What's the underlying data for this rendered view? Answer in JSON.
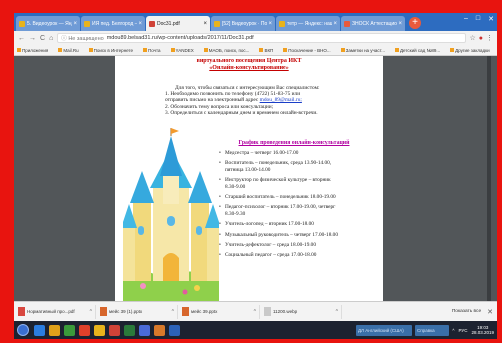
{
  "browser": {
    "tabs": [
      {
        "label": "5. Видеоурок — Яндекс",
        "icon_color": "#e8b31c",
        "active": false
      },
      {
        "label": "ИЯ пед. Белгород — Ян",
        "icon_color": "#e8b31c",
        "active": false
      },
      {
        "label": "Doc31.pdf",
        "icon_color": "#d04237",
        "active": true
      },
      {
        "label": "[52] Видеоурок · Поиск",
        "icon_color": "#e8b31c",
        "active": false
      },
      {
        "label": "тетр — Яндекс: нашлось",
        "icon_color": "#e8b31c",
        "active": false
      },
      {
        "label": "ЗНОСК Аттестационный",
        "icon_color": "#e85a3c",
        "active": false
      }
    ],
    "new_tab_label": "+",
    "address": {
      "nav_back": "←",
      "nav_forward": "→",
      "reload": "C",
      "home": "⌂",
      "security": "ⓘ Не защищено",
      "url": "mdou89.belsad31.ru/wp-content/uploads/2017/11/Doc31.pdf"
    },
    "bookmarks": [
      "Приложения",
      "Mail.Ru",
      "Поиск в Интернете",
      "Почта",
      "YANDEX",
      "МАОБ, поиск, пос...",
      "ВКП",
      "Поскачение - ВНО...",
      "Заметки на участ...",
      "Детский сад №89...",
      "Другие закладки"
    ]
  },
  "document": {
    "title_line1": "виртуального посещения Центра ИКТ",
    "title_line2": "«Онлайн-консультирование»",
    "intro": "Для того, чтобы связаться с интересующим Вас специалистом:",
    "step1a": "1.  Необходимо    позвонить   по  телефону  (4722)  51-83-75   или",
    "step1b": "     отправить письмо на электронный адрес ",
    "email": "mdou_89@mail.ru;",
    "step2": "2.  Обозначить тему вопроса или консультации;",
    "step3": "3.  Определиться с календарным днем и временем онлайн-встречи.",
    "schedule_title": "График проведения онлайн-консультаций",
    "schedule": [
      [
        "Медсестра – четверг 16.00-17.00"
      ],
      [
        "Воспитатель – понедельник, среда 13.90-14.00,",
        "пятница 13.00-14.00"
      ],
      [
        "Инструктор по физической культуре – вторник",
        "8.30-9.00"
      ],
      [
        "Старший воспитатель – понедельник 18.00-19.00"
      ],
      [
        "Педагог-психолог – вторник 17.00-19.00, четверг",
        "8.30-9.30"
      ],
      [
        "Учитель-логопед – вторник 17.00-18.00"
      ],
      [
        "Музыкальный руководитель – четверг 17.00-18.00"
      ],
      [
        "Учитель-дефектолог – среда 18.00-19.00"
      ],
      [
        "Социальный педагог – среда 17.00-18.00"
      ]
    ]
  },
  "downloads": {
    "items": [
      {
        "name": "Нормативный про...pdf",
        "type": "pdf"
      },
      {
        "name": "мейс 39 (1).pptx",
        "type": "ppt"
      },
      {
        "name": "мейс 39.pptx",
        "type": "ppt"
      },
      {
        "name": "11200.webp",
        "type": "img"
      }
    ],
    "show_all": "Показать все",
    "close": "✕"
  },
  "taskbar": {
    "icons": [
      "#2b7de0",
      "#e0a11a",
      "#3a9b3a",
      "#e0402a",
      "#e8b31c",
      "#d04237",
      "#2a7a3a",
      "#4a6ad8",
      "#d8792a",
      "#2c62b8"
    ],
    "input_placeholder": "ДЛ Английский (США)",
    "store_label": "Справка",
    "tray_lang": "РУС",
    "time": "19:03",
    "date": "28.03.2019"
  }
}
